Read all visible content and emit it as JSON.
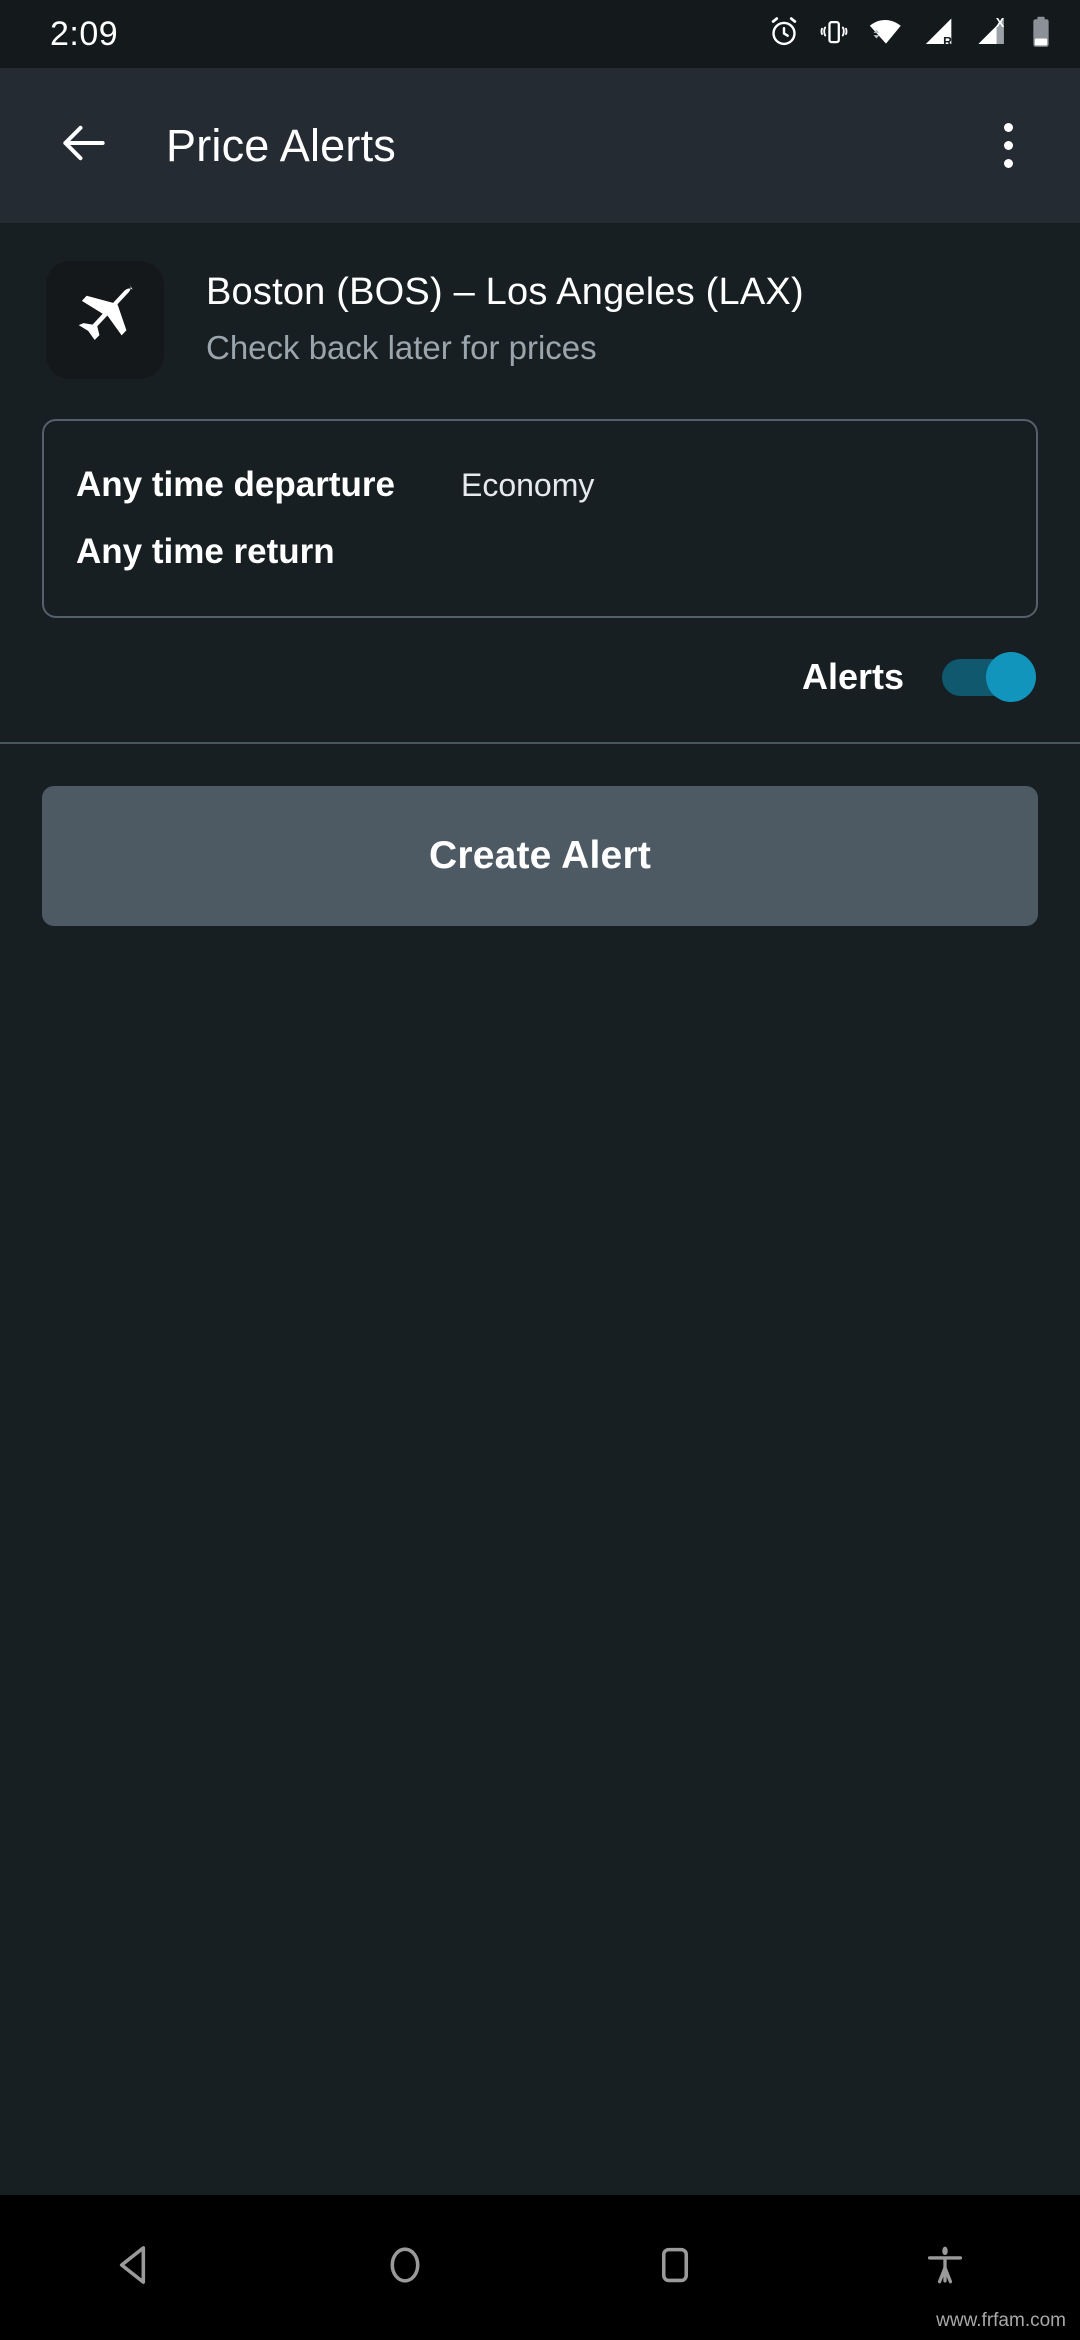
{
  "status_bar": {
    "time": "2:09",
    "icons": [
      "alarm-icon",
      "vibrate-icon",
      "wifi-icon",
      "signal-roaming-icon",
      "signal-x-icon",
      "battery-icon"
    ]
  },
  "app_bar": {
    "back_icon": "arrow-back-icon",
    "title": "Price Alerts",
    "overflow_icon": "more-vert-icon"
  },
  "flight": {
    "icon": "airplane-icon",
    "title": "Boston (BOS) – Los Angeles (LAX)",
    "subtitle": "Check back later for prices"
  },
  "details": {
    "departure": "Any time departure",
    "cabin_class": "Economy",
    "return": "Any time return"
  },
  "alerts": {
    "label": "Alerts",
    "enabled": true,
    "accent_color": "#1295bd",
    "track_color": "#10586e"
  },
  "actions": {
    "create_alert": "Create Alert",
    "create_alert_color": "#4e5a63"
  },
  "nav_bar": {
    "back": "nav-back-icon",
    "home": "nav-home-icon",
    "recents": "nav-recents-icon",
    "accessibility": "nav-accessibility-icon"
  },
  "watermark": "www.frfam.com",
  "colors": {
    "background": "#181f22",
    "app_bar": "#252b33",
    "status_bar": "#14191c",
    "muted_text": "#9aa5ac",
    "border": "#55606a"
  }
}
